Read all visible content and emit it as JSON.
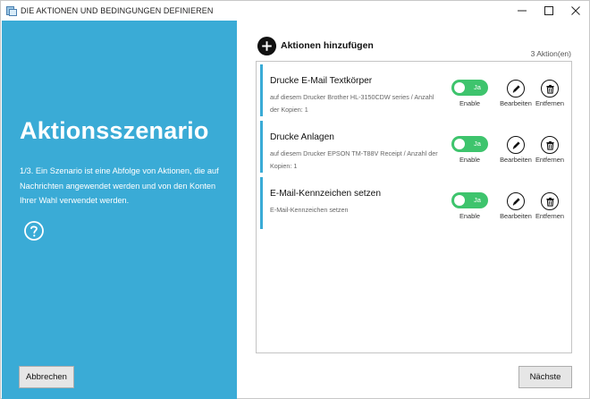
{
  "window": {
    "title": "DIE AKTIONEN UND BEDINGUNGEN DEFINIEREN"
  },
  "left": {
    "title": "Aktionsszenario",
    "description": "1/3. Ein Szenario ist eine Abfolge von Aktionen, die auf Nachrichten angewendet werden und von den Konten Ihrer Wahl verwendet werden.",
    "cancel_label": "Abbrechen"
  },
  "main": {
    "add_action_label": "Aktionen hinzufügen",
    "action_count": "3  Aktion(en)",
    "next_label": "Nächste",
    "actions": [
      {
        "title": "Drucke E-Mail Textkörper",
        "description": "auf diesem Drucker Brother HL-3150CDW series / Anzahl der Kopien: 1",
        "toggle_text": "Ja",
        "enable_label": "Enable",
        "edit_label": "Bearbeiten",
        "delete_label": "Entfernen",
        "enabled": true
      },
      {
        "title": "Drucke Anlagen",
        "description": "auf diesem Drucker EPSON TM-T88V Receipt / Anzahl der Kopien: 1",
        "toggle_text": "Ja",
        "enable_label": "Enable",
        "edit_label": "Bearbeiten",
        "delete_label": "Entfernen",
        "enabled": true
      },
      {
        "title": "E-Mail-Kennzeichen setzen",
        "description": "E-Mail-Kennzeichen setzen",
        "toggle_text": "Ja",
        "enable_label": "Enable",
        "edit_label": "Bearbeiten",
        "delete_label": "Entfernen",
        "enabled": true
      }
    ]
  },
  "colors": {
    "accent": "#3aabd6",
    "toggle_on": "#3ec46d"
  }
}
